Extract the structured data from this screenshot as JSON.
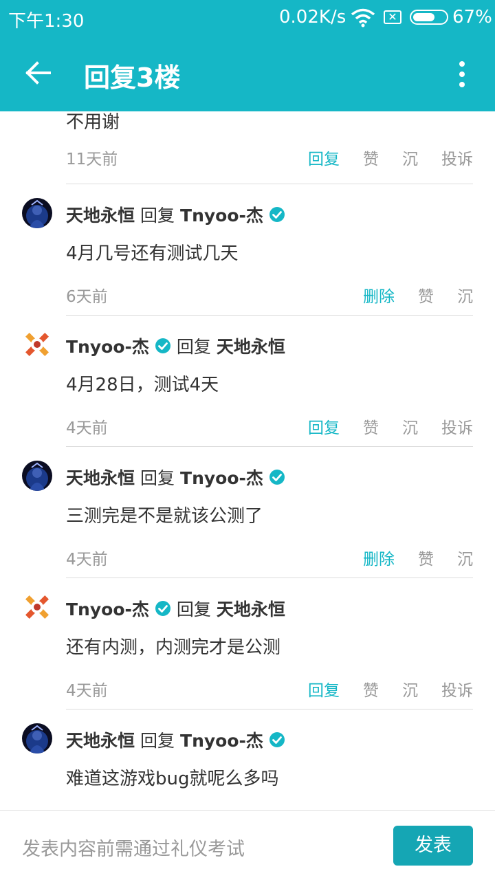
{
  "status_bar": {
    "time": "下午1:30",
    "net_speed": "0.02K/s",
    "battery_pct": "67%",
    "battery_level": 0.67
  },
  "app_bar": {
    "title": "回复3楼",
    "back_icon": "arrow-back-icon",
    "more_icon": "more-vert-icon"
  },
  "colors": {
    "accent": "#15b7c6",
    "button": "#15a6b4",
    "muted": "#999999"
  },
  "comments": [
    {
      "content": "不用谢",
      "time": "11天前",
      "actions": [
        "回复",
        "赞",
        "沉",
        "投诉"
      ]
    },
    {
      "author": "天地永恒",
      "reply_word": "回复",
      "target": "Tnyoo-杰",
      "badge": "target",
      "avatar": "dark-avatar",
      "content": "4月几号还有测试几天",
      "time": "6天前",
      "actions": [
        "删除",
        "赞",
        "沉"
      ]
    },
    {
      "author": "Tnyoo-杰",
      "reply_word": "回复",
      "target": "天地永恒",
      "badge": "author",
      "avatar": "logo-avatar",
      "content": "4月28日，测试4天",
      "time": "4天前",
      "actions": [
        "回复",
        "赞",
        "沉",
        "投诉"
      ]
    },
    {
      "author": "天地永恒",
      "reply_word": "回复",
      "target": "Tnyoo-杰",
      "badge": "target",
      "avatar": "dark-avatar",
      "content": "三测完是不是就该公测了",
      "time": "4天前",
      "actions": [
        "删除",
        "赞",
        "沉"
      ]
    },
    {
      "author": "Tnyoo-杰",
      "reply_word": "回复",
      "target": "天地永恒",
      "badge": "author",
      "avatar": "logo-avatar",
      "content": "还有内测，内测完才是公测",
      "time": "4天前",
      "actions": [
        "回复",
        "赞",
        "沉",
        "投诉"
      ]
    },
    {
      "author": "天地永恒",
      "reply_word": "回复",
      "target": "Tnyoo-杰",
      "badge": "target",
      "avatar": "dark-avatar",
      "content": "难道这游戏bug就呢么多吗",
      "time": "4天前",
      "actions": [
        "删除",
        "赞",
        "沉"
      ]
    }
  ],
  "composer": {
    "placeholder": "发表内容前需通过礼仪考试",
    "send_label": "发表"
  }
}
